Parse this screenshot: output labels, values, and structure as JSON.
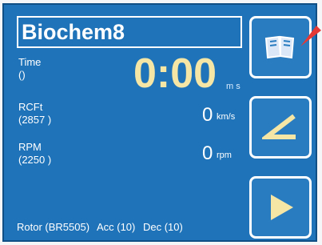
{
  "program": {
    "name": "Biochem8"
  },
  "time": {
    "label": "Time",
    "sub": "()",
    "value": "0:00",
    "unit": "m s"
  },
  "rcf": {
    "label": "RCFt",
    "sub": "(2857 )",
    "value": "0",
    "unit": "km/s"
  },
  "rpm": {
    "label": "RPM",
    "sub": "(2250 )",
    "value": "0",
    "unit": "rpm"
  },
  "status_bar": {
    "rotor": "Rotor (BR5505)",
    "acc": "Acc (10)",
    "dec": "Dec (10)"
  },
  "buttons": {
    "program_icon": "book-icon",
    "edit_icon": "angle-edit-icon",
    "start_icon": "play-icon"
  },
  "colors": {
    "screen_bg": "#1f73b8",
    "accent": "#f5e6a6",
    "pointer": "#e53935"
  }
}
